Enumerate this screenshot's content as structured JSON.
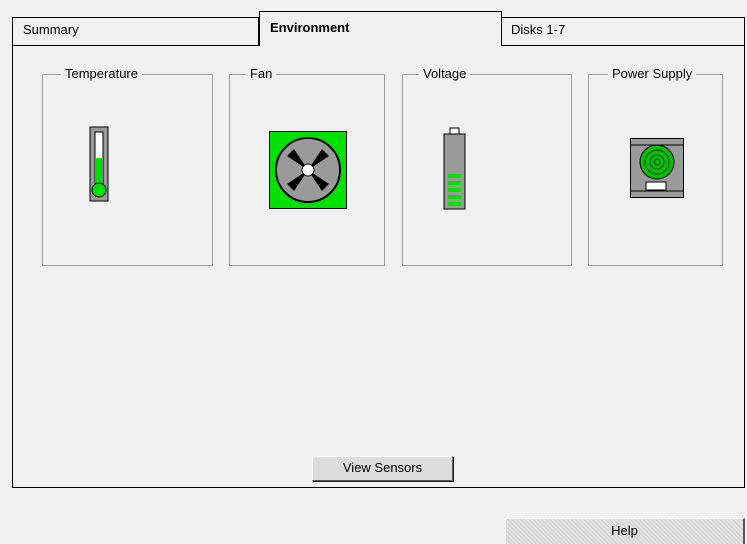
{
  "tabs": {
    "summary": "Summary",
    "environment": "Environment",
    "disks": "Disks 1-7"
  },
  "groups": {
    "temperature": {
      "label": "Temperature",
      "icon": "thermometer-icon",
      "level": 0.55
    },
    "fan": {
      "label": "Fan",
      "icon": "fan-icon"
    },
    "voltage": {
      "label": "Voltage",
      "icon": "battery-icon",
      "bars": 5
    },
    "power_supply": {
      "label": "Power Supply",
      "icon": "power-supply-icon"
    }
  },
  "buttons": {
    "view_sensors": "View Sensors",
    "help": "Help"
  },
  "colors": {
    "status_green": "#00e000",
    "panel_bg": "#f0f0f0"
  }
}
